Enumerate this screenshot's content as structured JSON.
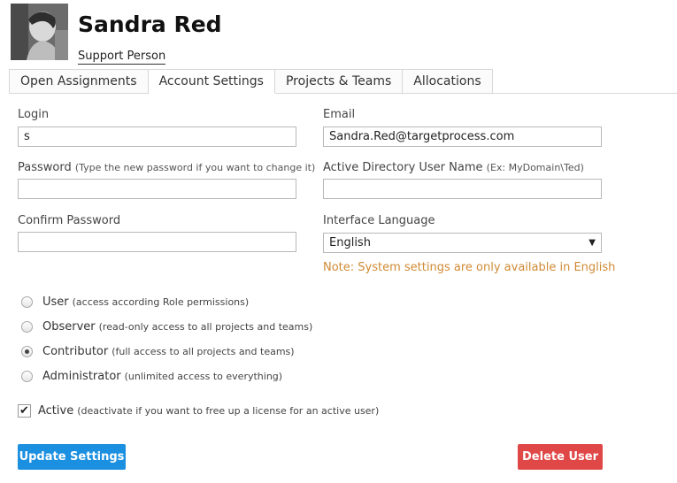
{
  "user": {
    "name": "Sandra Red",
    "role": "Support Person"
  },
  "tabs": [
    {
      "label": "Open Assignments",
      "active": false
    },
    {
      "label": "Account Settings",
      "active": true
    },
    {
      "label": "Projects & Teams",
      "active": false
    },
    {
      "label": "Allocations",
      "active": false
    }
  ],
  "form": {
    "login": {
      "label": "Login",
      "value": "s"
    },
    "email": {
      "label": "Email",
      "value": "Sandra.Red@targetprocess.com"
    },
    "password": {
      "label": "Password",
      "hint": "(Type the new password if you want to change it)",
      "value": ""
    },
    "ad_user": {
      "label": "Active Directory User Name",
      "hint": "(Ex: MyDomain\\Ted)",
      "value": ""
    },
    "confirm_password": {
      "label": "Confirm Password",
      "value": ""
    },
    "language": {
      "label": "Interface Language",
      "value": "English"
    },
    "note": "Note: System settings are only available in English"
  },
  "access_levels": [
    {
      "label": "User",
      "hint": "(access according Role permissions)",
      "checked": false
    },
    {
      "label": "Observer",
      "hint": "(read-only access to all projects and teams)",
      "checked": false
    },
    {
      "label": "Contributor",
      "hint": "(full access to all projects and teams)",
      "checked": true
    },
    {
      "label": "Administrator",
      "hint": "(unlimited access to everything)",
      "checked": false
    }
  ],
  "active": {
    "label": "Active",
    "hint": "(deactivate if you want to free up a license for an active user)",
    "checked": true
  },
  "buttons": {
    "update": "Update Settings",
    "delete": "Delete User"
  },
  "colors": {
    "primary": "#1b8fe0",
    "danger": "#e04848",
    "note": "#d08a34"
  }
}
